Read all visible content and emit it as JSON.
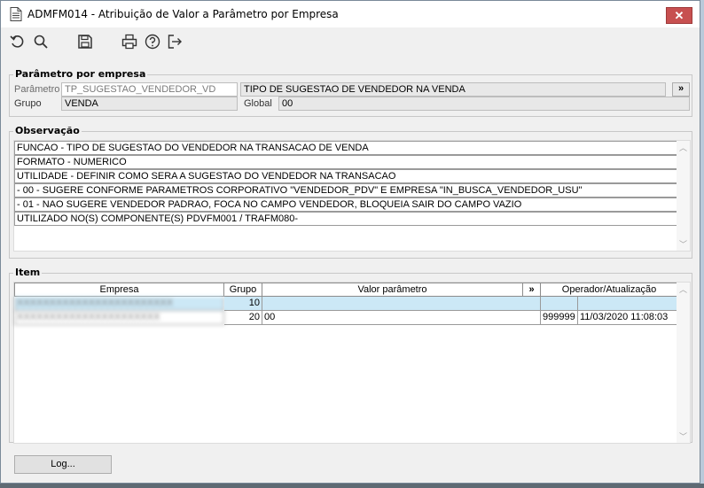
{
  "window": {
    "title": "ADMFM014 - Atribuição de Valor a Parâmetro por Empresa",
    "close_label": "✕"
  },
  "toolbar": {
    "icons": [
      "undo-icon",
      "search-icon",
      "save-icon",
      "print-icon",
      "help-icon",
      "exit-icon"
    ]
  },
  "parametro_empresa": {
    "legend": "Parâmetro por empresa",
    "parametro_label": "Parâmetro",
    "parametro_value": "TP_SUGESTAO_VENDEDOR_VD",
    "parametro_desc": "TIPO DE SUGESTAO DE VENDEDOR NA VENDA",
    "more_label": "»",
    "grupo_label": "Grupo",
    "grupo_value": "VENDA",
    "global_label": "Global",
    "global_value": "00"
  },
  "observacao": {
    "legend": "Observação",
    "lines": [
      "FUNCAO - TIPO DE SUGESTAO DO VENDEDOR NA TRANSACAO DE VENDA",
      "FORMATO - NUMERICO",
      "UTILIDADE - DEFINIR COMO SERA A SUGESTAO DO VENDEDOR NA TRANSACAO",
      " - 00 - SUGERE CONFORME PARAMETROS CORPORATIVO \"VENDEDOR_PDV\" E EMPRESA \"IN_BUSCA_VENDEDOR_USU\"",
      " - 01 - NAO SUGERE VENDEDOR PADRAO, FOCA NO CAMPO VENDEDOR, BLOQUEIA SAIR DO CAMPO VAZIO",
      "UTILIZADO NO(S) COMPONENTE(S) PDVFM001 / TRAFM080-"
    ]
  },
  "item": {
    "legend": "Item",
    "columns": {
      "empresa": "Empresa",
      "grupo": "Grupo",
      "valor": "Valor parâmetro",
      "more": "»",
      "operador": "Operador/Atualização"
    },
    "rows": [
      {
        "empresa": "XXXXXXXXXXXXXXXXXXXXXXXX",
        "grupo": "10",
        "valor": "",
        "operador": "",
        "atualizacao": ""
      },
      {
        "empresa": "XXXXXXXXXXXXXXXXXXXXXX",
        "grupo": "20",
        "valor": "00",
        "operador": "999999",
        "atualizacao": "11/03/2020 11:08:03"
      }
    ]
  },
  "footer": {
    "log_label": "Log..."
  }
}
